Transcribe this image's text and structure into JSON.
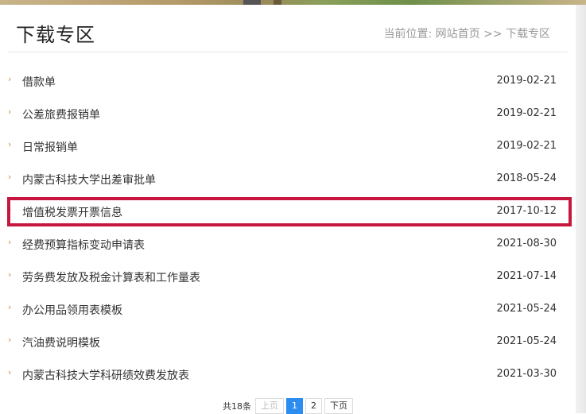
{
  "header": {
    "title": "下载专区",
    "breadcrumb": "当前位置: 网站首页 >> 下载专区"
  },
  "items": [
    {
      "title": "借款单",
      "date": "2019-02-21"
    },
    {
      "title": "公差旅费报销单",
      "date": "2019-02-21"
    },
    {
      "title": "日常报销单",
      "date": "2019-02-21"
    },
    {
      "title": "内蒙古科技大学出差审批单",
      "date": "2018-05-24"
    },
    {
      "title": "增值税发票开票信息",
      "date": "2017-10-12"
    },
    {
      "title": "经费预算指标变动申请表",
      "date": "2021-08-30"
    },
    {
      "title": "劳务费发放及税金计算表和工作量表",
      "date": "2021-07-14"
    },
    {
      "title": "办公用品领用表模板",
      "date": "2021-05-24"
    },
    {
      "title": "汽油费说明模板",
      "date": "2021-05-24"
    },
    {
      "title": "内蒙古科技大学科研绩效费发放表",
      "date": "2021-03-30"
    }
  ],
  "bullet": "›",
  "pagination": {
    "total": "共18条",
    "prev": "上页",
    "pages": [
      "1",
      "2"
    ],
    "current": "1",
    "next": "下页"
  },
  "colors": {
    "highlight": "#c8173e",
    "bullet": "#d08a3a",
    "current_page": "#2d8cf0"
  }
}
